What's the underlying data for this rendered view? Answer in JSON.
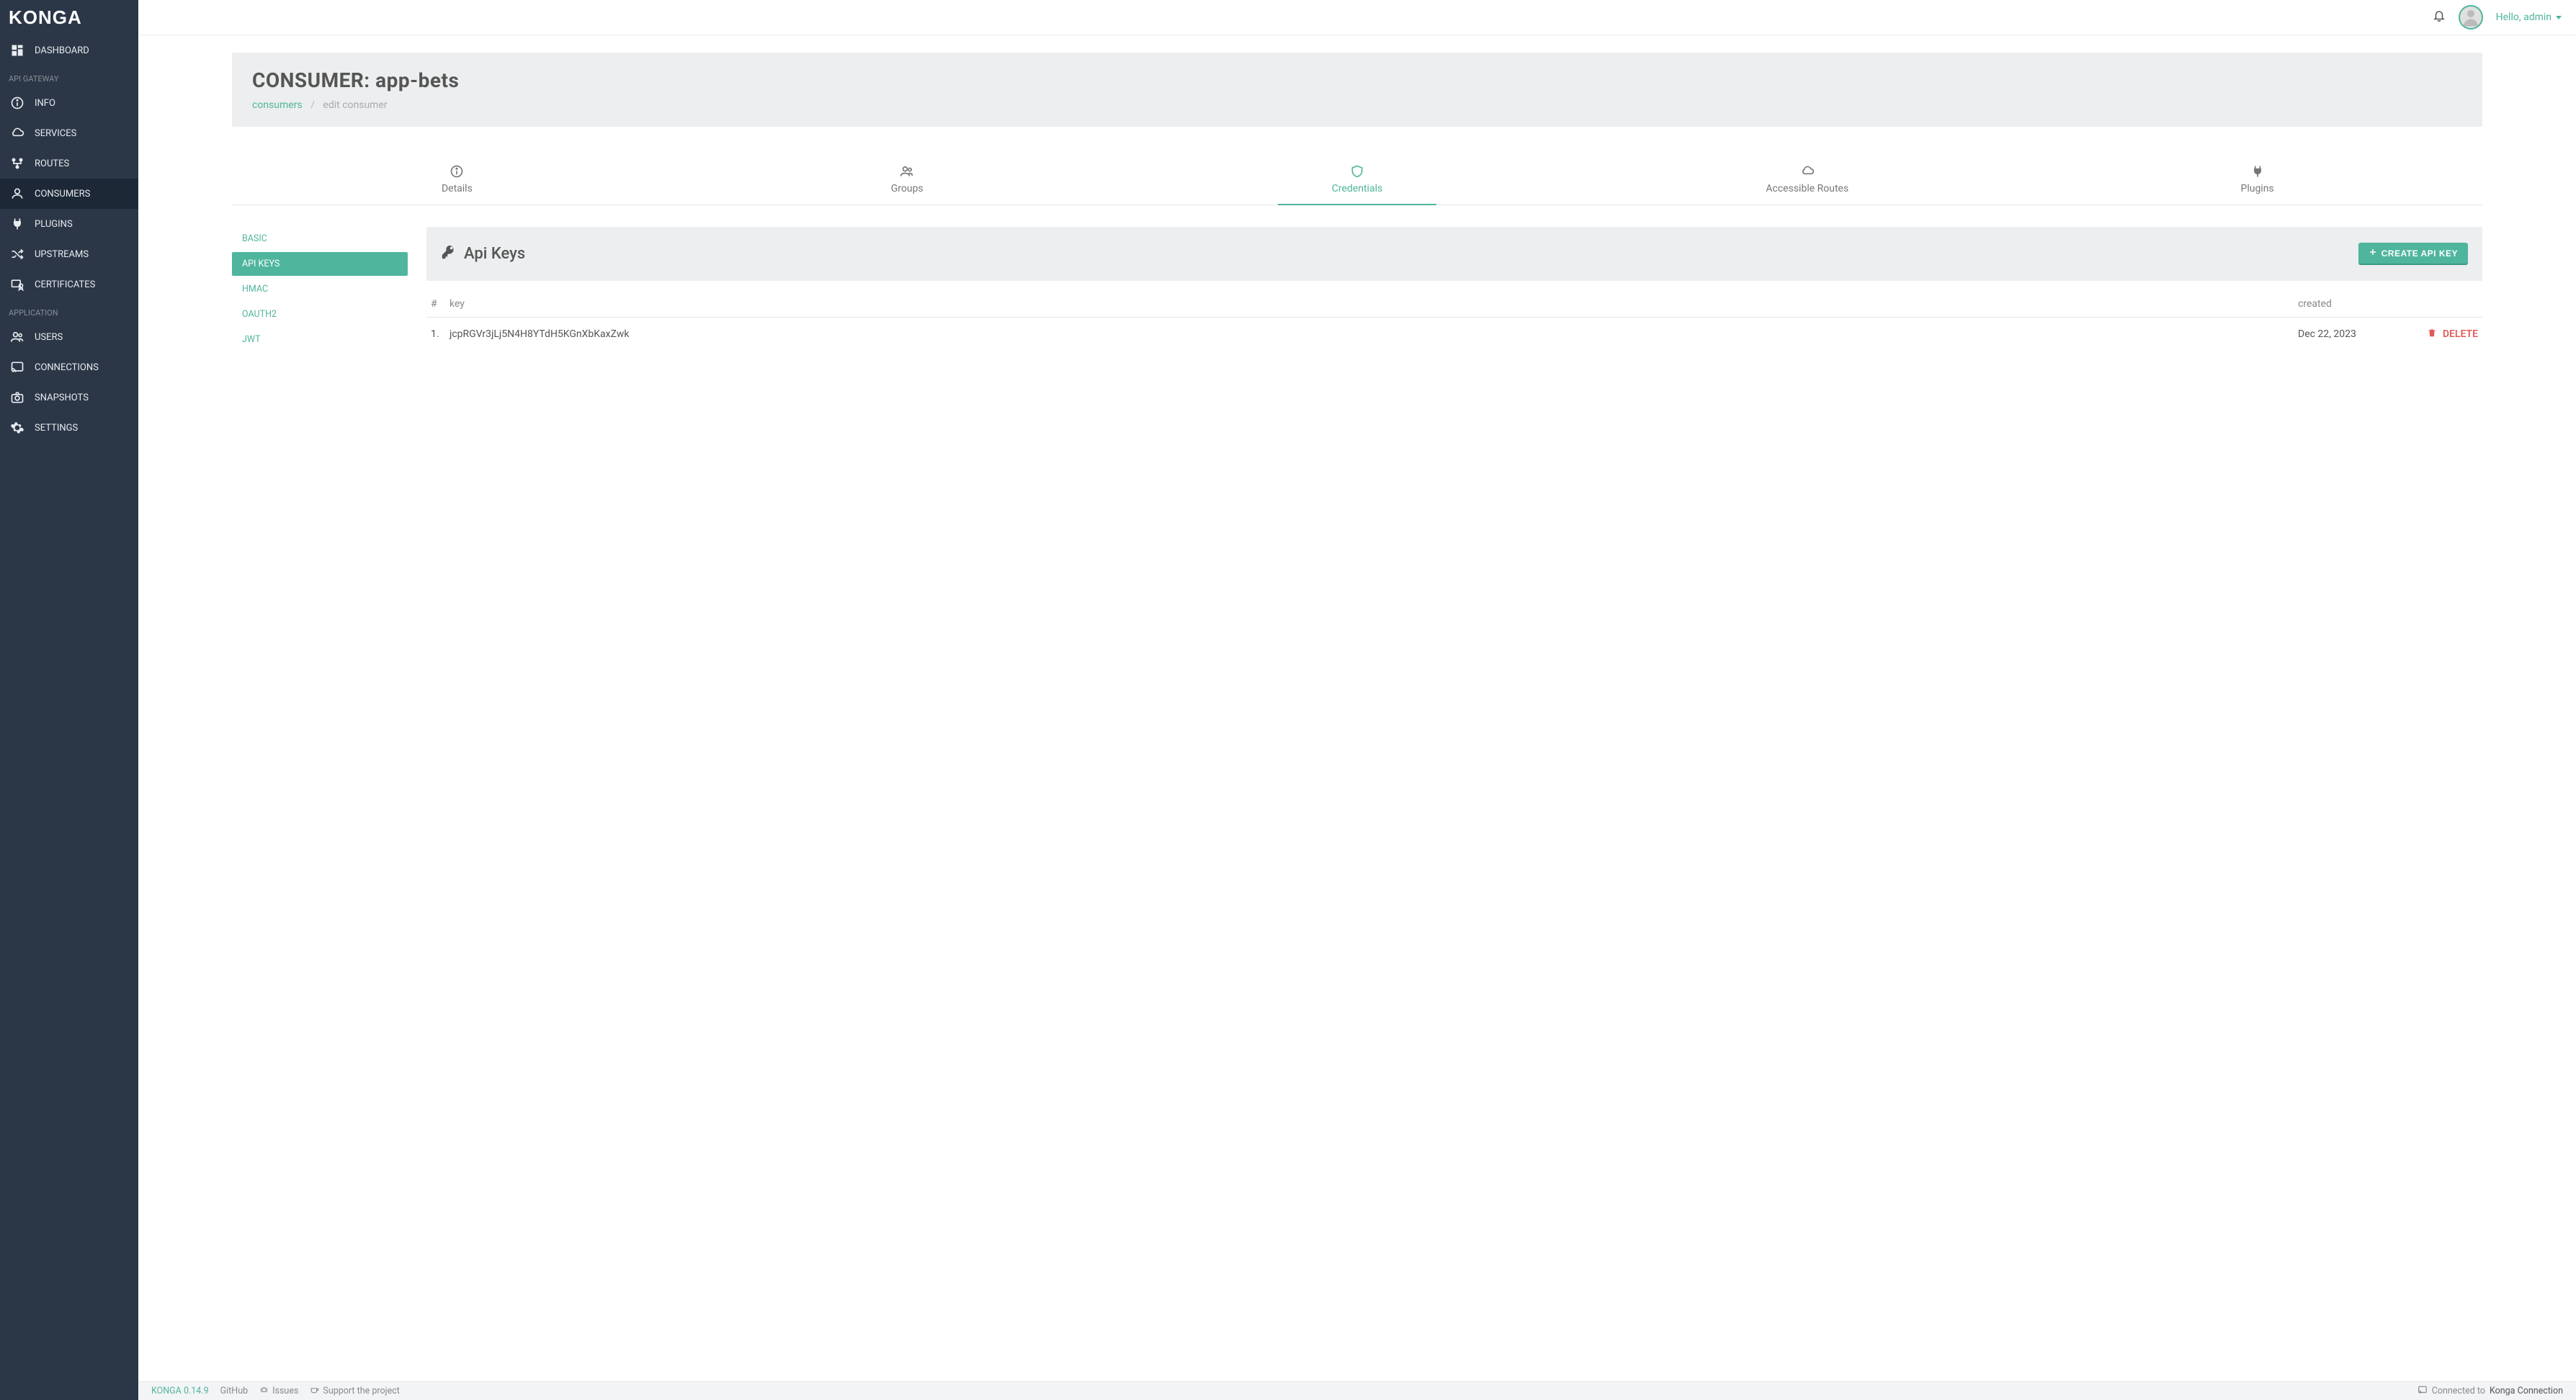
{
  "brand": "KONGA",
  "topbar": {
    "greeting": "Hello, admin"
  },
  "sidebar": {
    "section_gateway": "API GATEWAY",
    "section_app": "APPLICATION",
    "items": {
      "dashboard": {
        "label": "DASHBOARD"
      },
      "info": {
        "label": "INFO"
      },
      "services": {
        "label": "SERVICES"
      },
      "routes": {
        "label": "ROUTES"
      },
      "consumers": {
        "label": "CONSUMERS"
      },
      "plugins": {
        "label": "PLUGINS"
      },
      "upstreams": {
        "label": "UPSTREAMS"
      },
      "certificates": {
        "label": "CERTIFICATES"
      },
      "users": {
        "label": "USERS"
      },
      "connections": {
        "label": "CONNECTIONS"
      },
      "snapshots": {
        "label": "SNAPSHOTS"
      },
      "settings": {
        "label": "SETTINGS"
      }
    }
  },
  "page": {
    "title": "CONSUMER: app-bets",
    "breadcrumb": {
      "root": "consumers",
      "current": "edit consumer"
    }
  },
  "tabs": {
    "details": {
      "label": "Details"
    },
    "groups": {
      "label": "Groups"
    },
    "credentials": {
      "label": "Credentials"
    },
    "routes": {
      "label": "Accessible Routes"
    },
    "plugins": {
      "label": "Plugins"
    }
  },
  "cred_nav": {
    "basic": "BASIC",
    "apikeys": "API KEYS",
    "hmac": "HMAC",
    "oauth2": "OAUTH2",
    "jwt": "JWT"
  },
  "credentials": {
    "heading": "Api Keys",
    "create_button": "CREATE API KEY",
    "columns": {
      "num": "#",
      "key": "key",
      "created": "created"
    },
    "rows": [
      {
        "num": "1.",
        "key": "jcpRGVr3jLj5N4H8YTdH5KGnXbKaxZwk",
        "created": "Dec 22, 2023",
        "delete": "DELETE"
      }
    ]
  },
  "footer": {
    "brand": "KONGA 0.14.9",
    "github": "GitHub",
    "issues": "Issues",
    "support": "Support the project",
    "connected_prefix": "Connected to",
    "connection_name": "Konga Connection"
  }
}
